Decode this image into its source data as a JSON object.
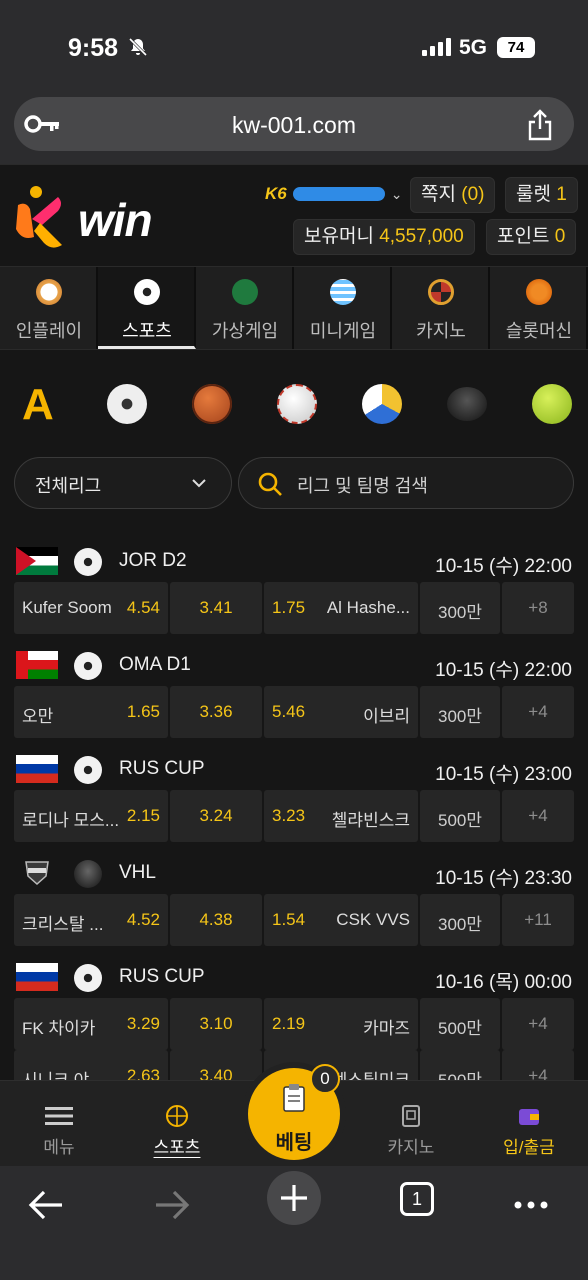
{
  "status_bar": {
    "time": "9:58",
    "network": "5G",
    "battery": "74"
  },
  "browser": {
    "url": "kw-001.com",
    "tab_count": "1"
  },
  "header": {
    "brand": "win",
    "user_level": "K6",
    "messages_label": "쪽지",
    "messages_count": "(0)",
    "roulette_label": "룰렛",
    "roulette_count": "1",
    "balance_label": "보유머니",
    "balance_value": "4,557,000",
    "points_label": "포인트",
    "points_value": "0"
  },
  "categories": [
    {
      "label": "인플레이",
      "icon": "clock-icon"
    },
    {
      "label": "스포츠",
      "icon": "soccer-ball-icon"
    },
    {
      "label": "가상게임",
      "icon": "bet365-icon"
    },
    {
      "label": "미니게임",
      "icon": "globe-icon"
    },
    {
      "label": "카지노",
      "icon": "roulette-icon"
    },
    {
      "label": "슬롯머신",
      "icon": "crown-icon"
    }
  ],
  "sport_filter": {
    "all_label": "A",
    "icons": [
      "soccer",
      "basketball",
      "baseball",
      "volleyball",
      "hockey",
      "tennis"
    ]
  },
  "filters": {
    "league_dropdown": "전체리그",
    "search_placeholder": "리그 및 팀명 검색"
  },
  "matches": [
    {
      "league": "JOR D2",
      "time": "10-15 (수) 22:00",
      "home": "Kufer Soom",
      "home_odd": "4.54",
      "draw": "3.41",
      "away_odd": "1.75",
      "away": "Al Hashe...",
      "limit": "300만",
      "more": "+8"
    },
    {
      "league": "OMA D1",
      "time": "10-15 (수) 22:00",
      "home": "오만",
      "home_odd": "1.65",
      "draw": "3.36",
      "away_odd": "5.46",
      "away": "이브리",
      "limit": "300만",
      "more": "+4"
    },
    {
      "league": "RUS CUP",
      "time": "10-15 (수) 23:00",
      "home": "로디나 모스...",
      "home_odd": "2.15",
      "draw": "3.24",
      "away_odd": "3.23",
      "away": "첼랴빈스크",
      "limit": "500만",
      "more": "+4"
    },
    {
      "league": "VHL",
      "time": "10-15 (수) 23:30",
      "home": "크리스탈 ...",
      "home_odd": "4.52",
      "draw": "4.38",
      "away_odd": "1.54",
      "away": "CSK VVS",
      "limit": "300만",
      "more": "+11"
    },
    {
      "league": "RUS CUP",
      "time": "10-16 (목) 00:00",
      "home": "FK 차이카",
      "home_odd": "3.29",
      "draw": "3.10",
      "away_odd": "2.19",
      "away": "카마즈",
      "limit": "500만",
      "more": "+4"
    },
    {
      "league": "",
      "time": "",
      "home": "시니크 야",
      "home_odd": "2.63",
      "draw": "3.40",
      "away_odd": "",
      "away": "텍스틸미크",
      "limit": "500만",
      "more": "+4"
    }
  ],
  "bottom_nav": {
    "menu": "메뉴",
    "sports": "스포츠",
    "bet": "베팅",
    "bet_count": "0",
    "casino": "카지노",
    "deposit": "입/출금"
  },
  "colors": {
    "accent": "#f5c518",
    "bet_button": "#f5b400",
    "background": "#161616"
  }
}
